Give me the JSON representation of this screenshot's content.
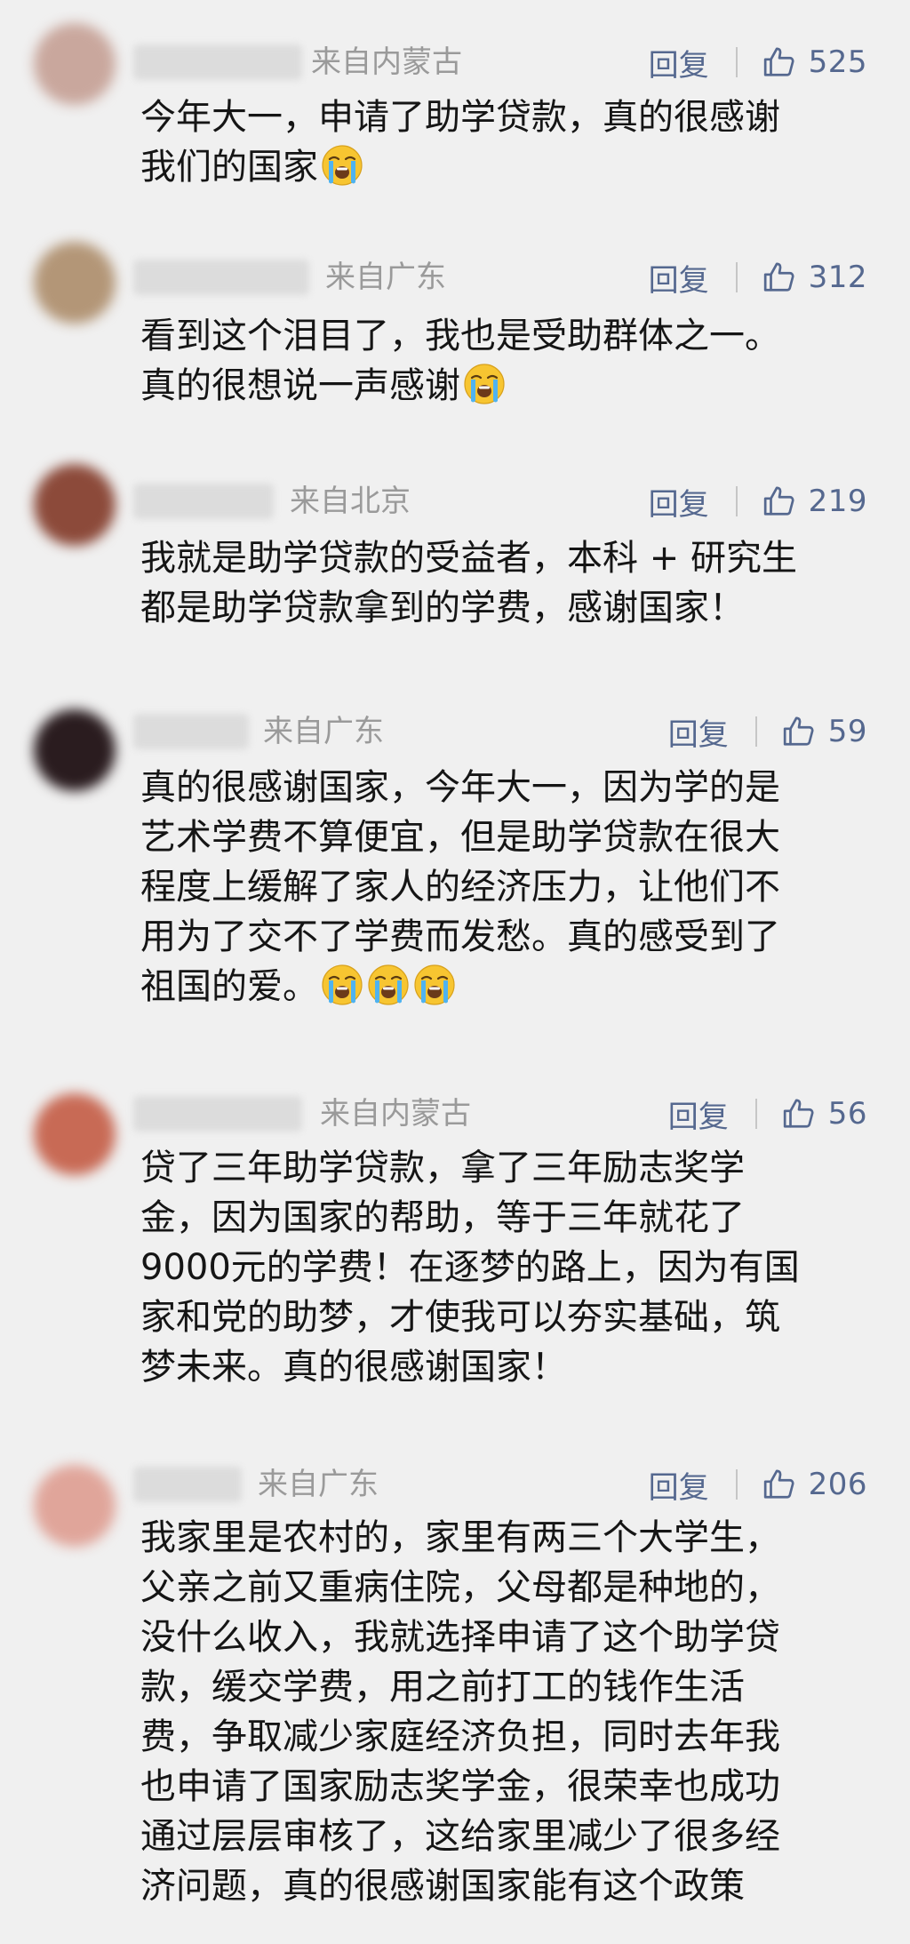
{
  "colors": {
    "background": "#f0f0f0",
    "action_blue": "#55688f",
    "location_gray": "#9a9a9a",
    "text": "#151515"
  },
  "icons": {
    "like": "thumbs-up-icon",
    "emoji": "loudly-crying-face-emoji"
  },
  "labels": {
    "reply": "回复"
  },
  "comments": [
    {
      "location": "来自内蒙古",
      "likes": "525",
      "lines": [
        "今年大一，申请了助学贷款，真的很感谢",
        "我们的国家"
      ],
      "emoji_count": 1
    },
    {
      "location": "来自广东",
      "likes": "312",
      "lines": [
        "看到这个泪目了，我也是受助群体之一。",
        "真的很想说一声感谢"
      ],
      "emoji_count": 1
    },
    {
      "location": "来自北京",
      "likes": "219",
      "lines": [
        "我就是助学贷款的受益者，本科 + 研究生",
        "都是助学贷款拿到的学费，感谢国家！"
      ],
      "emoji_count": 0
    },
    {
      "location": "来自广东",
      "likes": "59",
      "lines": [
        "真的很感谢国家，今年大一，因为学的是",
        "艺术学费不算便宜，但是助学贷款在很大",
        "程度上缓解了家人的经济压力，让他们不",
        "用为了交不了学费而发愁。真的感受到了",
        "祖国的爱。"
      ],
      "emoji_count": 3
    },
    {
      "location": "来自内蒙古",
      "likes": "56",
      "lines": [
        "贷了三年助学贷款，拿了三年励志奖学",
        "金，因为国家的帮助，等于三年就花了",
        "9000元的学费！在逐梦的路上，因为有国",
        "家和党的助梦，才使我可以夯实基础，筑",
        "梦未来。真的很感谢国家！"
      ],
      "emoji_count": 0
    },
    {
      "location": "来自广东",
      "likes": "206",
      "lines": [
        "我家里是农村的，家里有两三个大学生，",
        "父亲之前又重病住院，父母都是种地的，",
        "没什么收入，我就选择申请了这个助学贷",
        "款，缓交学费，用之前打工的钱作生活",
        "费，争取减少家庭经济负担，同时去年我",
        "也申请了国家励志奖学金，很荣幸也成功",
        "通过层层审核了，这给家里减少了很多经",
        "济问题，真的很感谢国家能有这个政策"
      ],
      "emoji_count": 0
    }
  ]
}
